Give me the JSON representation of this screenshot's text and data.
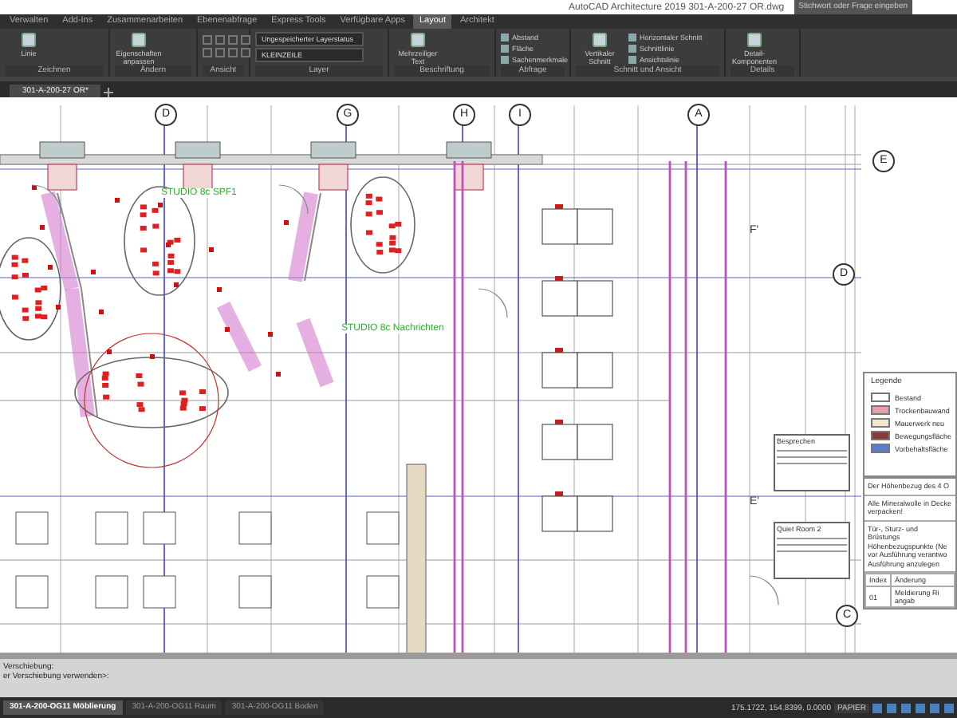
{
  "window": {
    "title": "AutoCAD Architecture 2019   301-A-200-27 OR.dwg",
    "search_placeholder": "Stichwort oder Frage eingeben"
  },
  "ribbon_tabs": [
    {
      "label": "Verwalten",
      "selected": false
    },
    {
      "label": "Add-Ins",
      "selected": false
    },
    {
      "label": "Zusammenarbeiten",
      "selected": false
    },
    {
      "label": "Ebenenabfrage",
      "selected": false
    },
    {
      "label": "Express Tools",
      "selected": false
    },
    {
      "label": "Verfügbare Apps",
      "selected": false
    },
    {
      "label": "Layout",
      "selected": true
    },
    {
      "label": "Architekt",
      "selected": false
    }
  ],
  "ribbon_panels": [
    {
      "title": "Zeichnen",
      "tools": [
        {
          "kind": "large",
          "label": "Linie"
        }
      ]
    },
    {
      "title": "Ändern",
      "tools": [
        {
          "kind": "large",
          "label": "Eigenschaften anpassen"
        }
      ]
    },
    {
      "title": "Ansicht"
    },
    {
      "title": "Layer",
      "tools": [
        {
          "kind": "dropdown",
          "label": "Ungespeicherter Layerstatus"
        },
        {
          "kind": "dropdown",
          "label": "KLEINZEILE"
        }
      ]
    },
    {
      "title": "Beschriftung",
      "tools": [
        {
          "kind": "large",
          "label": "Mehrzeiliger Text"
        }
      ]
    },
    {
      "title": "Abfrage",
      "tools": [
        {
          "kind": "small",
          "label": "Abstand"
        },
        {
          "kind": "small",
          "label": "Fläche"
        },
        {
          "kind": "small",
          "label": "Sachenmerkmale"
        }
      ]
    },
    {
      "title": "Schnitt und Ansicht",
      "tools": [
        {
          "kind": "large",
          "label": "Vertikaler Schnitt"
        },
        {
          "kind": "small",
          "label": "Horizontaler Schnitt"
        },
        {
          "kind": "small",
          "label": "Schnittlinie"
        },
        {
          "kind": "small",
          "label": "Ansichtslinie"
        }
      ]
    },
    {
      "title": "Details",
      "tools": [
        {
          "kind": "large",
          "label": "Detail-Komponenten"
        }
      ]
    }
  ],
  "file_tabs": [
    {
      "label": "301-A-200-27 OR*",
      "selected": true
    }
  ],
  "grid_bubbles": [
    {
      "label": "D"
    },
    {
      "label": "G"
    },
    {
      "label": "H"
    },
    {
      "label": "I"
    },
    {
      "label": "A"
    },
    {
      "label": "E"
    },
    {
      "label": "D"
    },
    {
      "label": "C"
    }
  ],
  "grid_marks": [
    {
      "label": "F'"
    },
    {
      "label": "E'"
    }
  ],
  "room_labels": [
    {
      "label": "STUDIO 8c SPF1"
    },
    {
      "label": "STUDIO 8c Nachrichten"
    }
  ],
  "room_info": [
    {
      "title": "Besprechen"
    },
    {
      "title": "Quiet Room 2"
    }
  ],
  "legend": {
    "title": "Legende",
    "items": [
      {
        "label": "Bestand",
        "color": "#ffffff"
      },
      {
        "label": "Trockenbauwand",
        "color": "#e8a0a8"
      },
      {
        "label": "Mauerwerk neu",
        "color": "#f4e6cc"
      },
      {
        "label": "Bewegungsfläche",
        "color": "#8a3a3a"
      },
      {
        "label": "Vorbehaltsfläche",
        "color": "#5a7ccc"
      }
    ]
  },
  "notes": [
    "Der Höhenbezug des 4 O",
    "Alle Mineralwolle in Decke verpacken!",
    "Tür-, Sturz- und Brüstungs Höhenbezugspunkte (Ne vor Ausführung verantwo Ausführung anzulegen"
  ],
  "revision_table": {
    "columns": [
      "Index",
      "Änderung"
    ],
    "rows": [
      [
        "01",
        "Meldierung Ri angab"
      ]
    ]
  },
  "command_lines": [
    "Verschiebung:",
    "er Verschiebung verwenden>:"
  ],
  "layout_tabs": [
    {
      "label": "301-A-200-OG11 Möblierung",
      "selected": true
    },
    {
      "label": "301-A-200-OG11 Raum",
      "selected": false
    },
    {
      "label": "301-A-200-OG11 Boden",
      "selected": false
    }
  ],
  "status_bar": {
    "coordinates": "175.1722, 154.8399, 0.0000",
    "space": "PAPIER"
  }
}
